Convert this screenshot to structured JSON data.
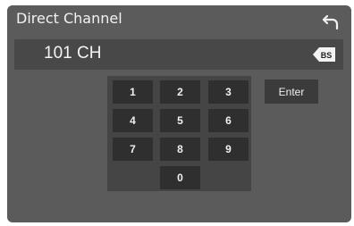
{
  "header": {
    "title": "Direct Channel",
    "back_icon": "return-arrow-icon"
  },
  "display": {
    "value": "101 CH",
    "backspace_label": "BS"
  },
  "keypad": {
    "keys": [
      "1",
      "2",
      "3",
      "4",
      "5",
      "6",
      "7",
      "8",
      "9",
      "0"
    ]
  },
  "enter_label": "Enter",
  "colors": {
    "background": "#5b5b5b",
    "key": "#2f2f2f",
    "text": "#f2f2f2"
  }
}
